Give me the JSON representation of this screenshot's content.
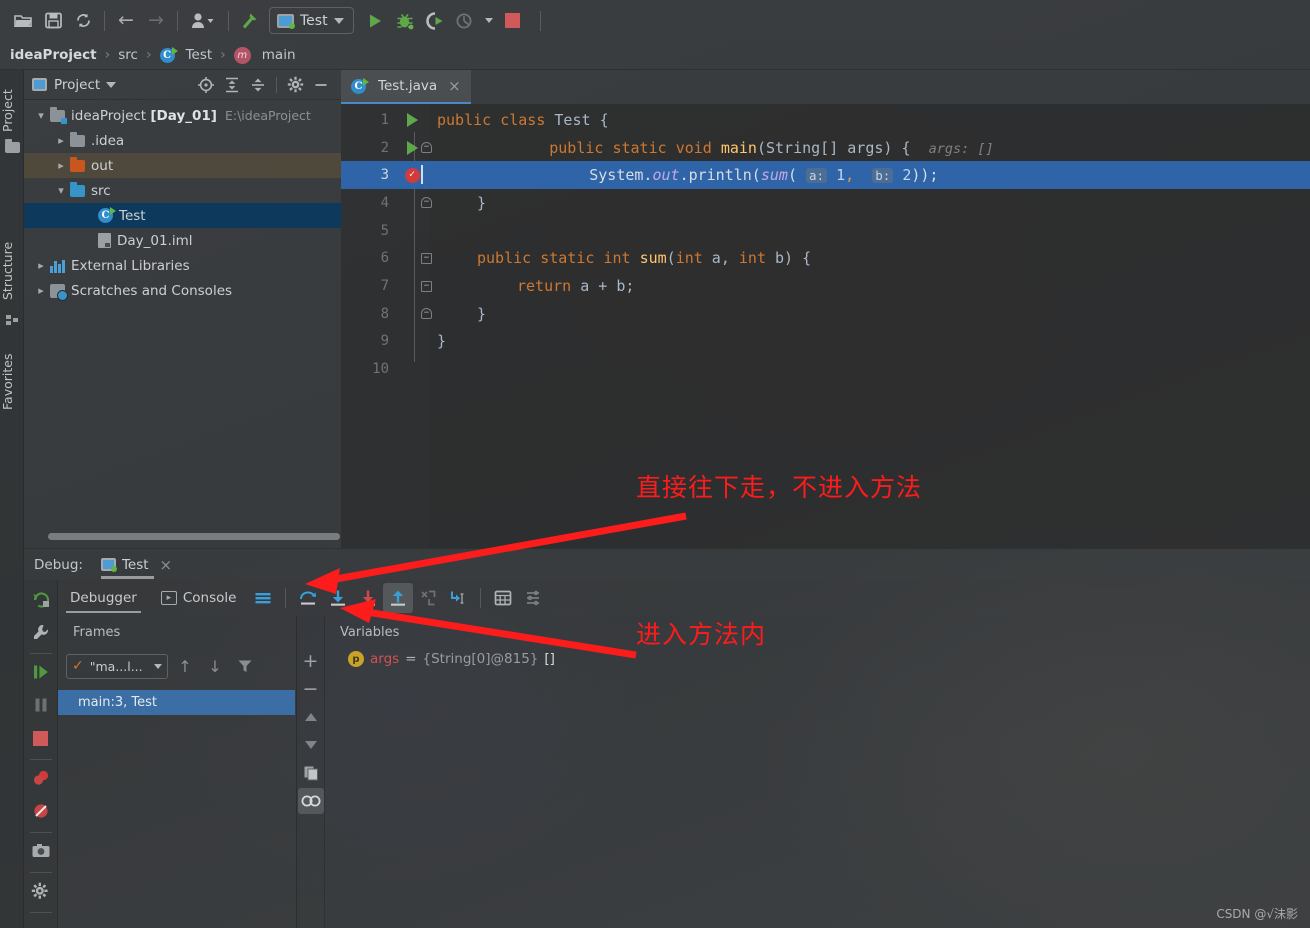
{
  "toolbar": {
    "icons": [
      "open-folder-icon",
      "save-icon",
      "sync-icon",
      "back-arrow-icon",
      "forward-arrow-icon",
      "user-icon",
      "build-hammer-icon"
    ],
    "run_config": {
      "label": "Test",
      "icon": "run-configuration-icon"
    },
    "run_label": "Run",
    "debug_label": "Debug",
    "run_coverage_label": "Run with Coverage",
    "profile_label": "Profile",
    "stop_label": "Stop",
    "accent_green": "#5fa84a",
    "accent_red": "#d05a5a"
  },
  "breadcrumb": {
    "items": [
      {
        "label": "ideaProject",
        "icon": "project-icon",
        "bold": true
      },
      {
        "label": "src",
        "icon": "folder-icon",
        "bold": false
      },
      {
        "label": "Test",
        "icon": "class-icon",
        "bold": false
      },
      {
        "label": "main",
        "icon": "method-icon",
        "bold": false
      }
    ],
    "separator": "›"
  },
  "left_rail": {
    "tabs": [
      {
        "label": "Project",
        "icon": "project-tool-icon"
      },
      {
        "label": "Structure",
        "icon": "structure-tool-icon"
      },
      {
        "label": "Favorites",
        "icon": "favorites-tool-icon"
      }
    ]
  },
  "project_panel": {
    "title": "Project",
    "tools": [
      "locate-icon",
      "expand-all-icon",
      "collapse-all-icon",
      "gear-icon",
      "minimize-icon"
    ],
    "tree": [
      {
        "label": "ideaProject ",
        "bold_label": "[Day_01]",
        "path": "E:\\ideaProject",
        "icon": "module-folder-icon",
        "chevron": "⌄",
        "depth": 0,
        "state": "normal"
      },
      {
        "label": ".idea",
        "icon": "folder-icon",
        "chevron": "›",
        "depth": 1,
        "state": "normal"
      },
      {
        "label": "out",
        "icon": "folder-orange-icon",
        "chevron": "›",
        "depth": 1,
        "state": "highlighted"
      },
      {
        "label": "src",
        "icon": "folder-blue-icon",
        "chevron": "⌄",
        "depth": 1,
        "state": "normal"
      },
      {
        "label": "Test",
        "icon": "java-class-icon",
        "chevron": "",
        "depth": 2,
        "state": "selected"
      },
      {
        "label": "Day_01.iml",
        "icon": "iml-file-icon",
        "chevron": "",
        "depth": 1,
        "state": "normal"
      },
      {
        "label": "External Libraries",
        "icon": "libraries-icon",
        "chevron": "›",
        "depth": 0,
        "state": "normal"
      },
      {
        "label": "Scratches and Consoles",
        "icon": "scratches-icon",
        "chevron": "›",
        "depth": 0,
        "state": "normal"
      }
    ]
  },
  "editor": {
    "tab": {
      "label": "Test.java",
      "icon": "java-class-icon",
      "close": "×"
    },
    "line_numbers": [
      "1",
      "2",
      "3",
      "4",
      "5",
      "6",
      "7",
      "8",
      "9",
      "10"
    ],
    "highlighted_line": 3,
    "breakpoint_line": 3,
    "run_marker_lines": [
      1,
      2
    ],
    "inlay_hint_main": "args: []",
    "param_hint_a": "a:",
    "param_hint_b": "b:",
    "code": {
      "l1_kw1": "public",
      "l1_kw2": "class",
      "l1_name": "Test",
      "l1_brace": "{",
      "l2_kw1": "public",
      "l2_kw2": "static",
      "l2_kw3": "void",
      "l2_name": "main",
      "l2_sig": "(String[] args) {",
      "l3_sys": "System.",
      "l3_out": "out",
      "l3_print": ".println(",
      "l3_sum": "sum",
      "l3_open": "( ",
      "l3_num1": "1",
      "l3_comma": ",  ",
      "l3_num2": "2",
      "l3_close": "));",
      "l4": "}",
      "l6_kw1": "public",
      "l6_kw2": "static",
      "l6_kw3": "int",
      "l6_name": "sum",
      "l6_sig_open": "(",
      "l6_kw4": "int",
      "l6_a": " a, ",
      "l6_kw5": "int",
      "l6_b": " b) {",
      "l7_kw": "return",
      "l7_expr": " a + b;",
      "l8": "}",
      "l9": "}"
    }
  },
  "debug": {
    "header_label": "Debug:",
    "session_tab": "Test",
    "session_close": "×",
    "rail_buttons": [
      "rerun-icon",
      "settings-wrench-icon",
      "resume-program-icon",
      "pause-program-icon",
      "stop-icon",
      "view-breakpoints-icon",
      "mute-breakpoints-icon",
      "screenshot-icon",
      "settings-gear-icon"
    ],
    "tabs": [
      {
        "label": "Debugger",
        "icon": "",
        "active": true
      },
      {
        "label": "Console",
        "icon": "console-icon",
        "active": false
      }
    ],
    "step_buttons": [
      {
        "name": "show-execution-point-icon",
        "label": "Show Execution Point"
      },
      {
        "name": "step-over-icon",
        "label": "Step Over"
      },
      {
        "name": "step-into-icon",
        "label": "Step Into"
      },
      {
        "name": "force-step-into-icon",
        "label": "Force Step Into"
      },
      {
        "name": "step-out-icon",
        "label": "Step Out"
      },
      {
        "name": "drop-frame-icon",
        "label": "Drop Frame"
      },
      {
        "name": "run-to-cursor-icon",
        "label": "Run to Cursor"
      },
      {
        "name": "evaluate-expression-icon",
        "label": "Evaluate Expression"
      },
      {
        "name": "layout-settings-icon",
        "label": "Layout Settings"
      }
    ],
    "frames": {
      "title": "Frames",
      "thread_value": "\"ma...l...",
      "controls": [
        "up-arrow-icon",
        "down-arrow-icon",
        "filter-icon"
      ],
      "rows": [
        "main:3, Test"
      ]
    },
    "variables": {
      "title": "Variables",
      "side_buttons": [
        "add-icon",
        "remove-icon",
        "up-icon",
        "down-icon",
        "copy-icon",
        "watches-icon"
      ],
      "rows": [
        {
          "badge": "p",
          "name": "args",
          "eq": "=",
          "value": "{String[0]@815}",
          "extra": "[]"
        }
      ]
    }
  },
  "annotations": [
    {
      "id": "anno-step-over",
      "text": "直接往下走，不进入方法",
      "color": "#fd1c1c"
    },
    {
      "id": "anno-step-into",
      "text": "进入方法内",
      "color": "#fd1c1c"
    }
  ],
  "watermark": {
    "text": "CSDN @√沬影"
  }
}
